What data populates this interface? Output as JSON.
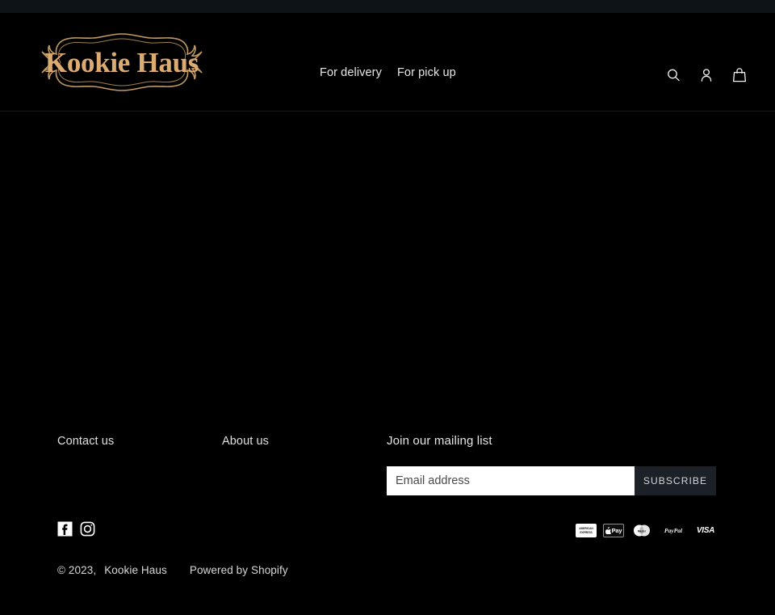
{
  "site": {
    "brand": "Kookie Haus",
    "logo_text": "Kookie Haus",
    "accent_gold": "#dcab72",
    "background": "#000000",
    "top_strip_color": "#0e1317"
  },
  "header": {
    "nav": [
      {
        "label": "For delivery",
        "name": "nav-for-delivery"
      },
      {
        "label": "For pick up",
        "name": "nav-for-pick-up"
      }
    ],
    "icons": [
      {
        "name": "search-icon",
        "label": "Search"
      },
      {
        "name": "account-icon",
        "label": "Log in"
      },
      {
        "name": "cart-icon",
        "label": "Cart"
      }
    ]
  },
  "footer": {
    "links": [
      {
        "label": "Contact us",
        "name": "footer-link-contact-us"
      },
      {
        "label": "About us",
        "name": "footer-link-about-us"
      }
    ],
    "newsletter": {
      "heading": "Join our mailing list",
      "email_placeholder": "Email address",
      "email_value": "",
      "subscribe_label": "SUBSCRIBE"
    },
    "social": [
      {
        "name": "facebook-icon",
        "label": "Facebook"
      },
      {
        "name": "instagram-icon",
        "label": "Instagram"
      }
    ],
    "payments": [
      {
        "name": "amex-icon",
        "label": "American Express",
        "line1": "AMERICAN",
        "line2": "EXPRESS"
      },
      {
        "name": "apple-pay-icon",
        "label": "Apple Pay",
        "text": "Pay"
      },
      {
        "name": "mastercard-icon",
        "label": "Master",
        "text": "Master"
      },
      {
        "name": "paypal-icon",
        "label": "PayPal",
        "text": "PayPal"
      },
      {
        "name": "visa-icon",
        "label": "Visa",
        "text": "VISA"
      }
    ],
    "copyright": "© 2023,",
    "copyright_brand": "Kookie Haus",
    "powered_by": "Powered by Shopify"
  }
}
